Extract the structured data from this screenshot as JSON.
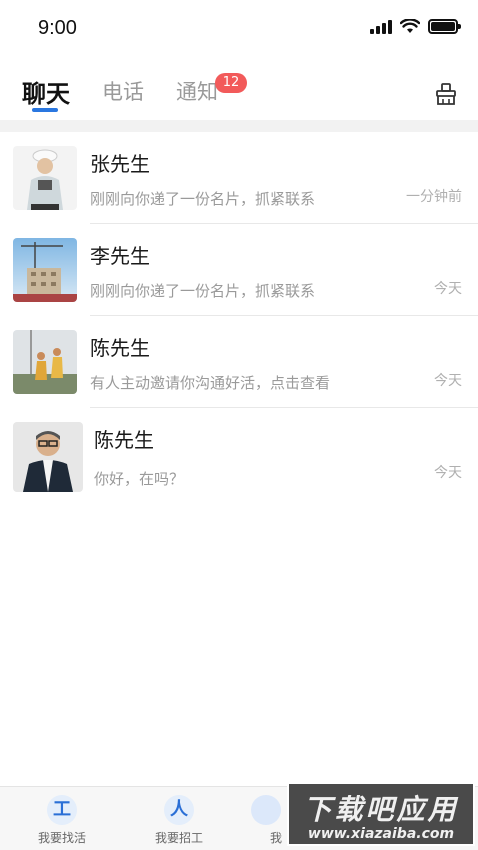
{
  "status_bar": {
    "time": "9:00",
    "icons": [
      "signal-icon",
      "wifi-icon",
      "battery-icon"
    ]
  },
  "tabs": [
    {
      "label": "聊天",
      "active": true
    },
    {
      "label": "电话",
      "active": false
    },
    {
      "label": "通知",
      "active": false,
      "badge": "12"
    }
  ],
  "header": {
    "clean_icon": "broom-icon"
  },
  "accent_color": "#2a77e0",
  "badge_color": "#f25a5a",
  "chats": [
    {
      "name": "张先生",
      "preview": "刚刚向你递了一份名片，抓紧联系",
      "time": "一分钟前",
      "avatar": "worker-photo"
    },
    {
      "name": "李先生",
      "preview": "刚刚向你递了一份名片，抓紧联系",
      "time": "今天",
      "avatar": "construction-site-photo"
    },
    {
      "name": "陈先生",
      "preview": "有人主动邀请你沟通好活，点击查看",
      "time": "今天",
      "avatar": "workers-photo"
    },
    {
      "name": "陈先生",
      "preview": "你好，在吗？",
      "time": "今天",
      "avatar": "businessman-photo"
    }
  ],
  "bottom_nav": [
    {
      "label": "我要找活",
      "icon": "工"
    },
    {
      "label": "我要招工",
      "icon": "人"
    },
    {
      "label": "我",
      "icon": ""
    }
  ],
  "watermark": {
    "top": "下载吧应用",
    "bottom": "www.xiazaiba.com"
  }
}
